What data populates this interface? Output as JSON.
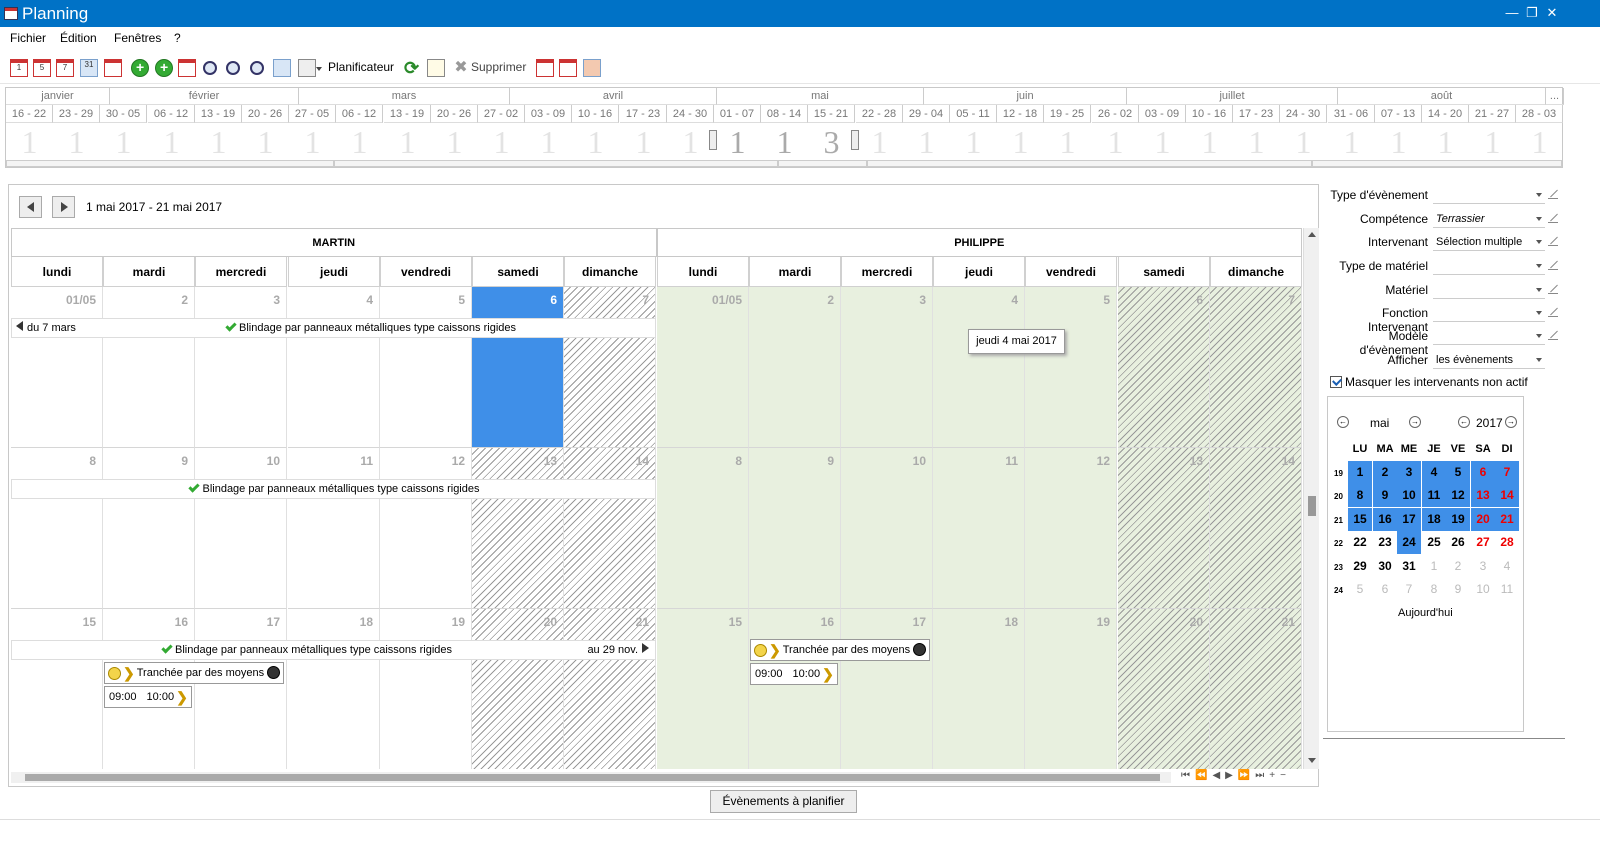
{
  "window": {
    "title": "Planning"
  },
  "menu": [
    "Fichier",
    "Édition",
    "Fenêtres",
    "?"
  ],
  "toolbar": {
    "planificateur": "Planificateur",
    "supprimer": "Supprimer",
    "cal_labels": [
      "1",
      "5",
      "7",
      "31"
    ]
  },
  "timeline": {
    "months": [
      "janvier",
      "février",
      "mars",
      "avril",
      "mai",
      "juin",
      "juillet",
      "août",
      "..."
    ],
    "weeks": [
      "16 - 22",
      "23 - 29",
      "30 - 05",
      "06 - 12",
      "13 - 19",
      "20 - 26",
      "27 - 05",
      "06 - 12",
      "13 - 19",
      "20 - 26",
      "27 - 02",
      "03 - 09",
      "10 - 16",
      "17 - 23",
      "24 - 30",
      "01 - 07",
      "08 - 14",
      "15 - 21",
      "22 - 28",
      "29 - 04",
      "05 - 11",
      "12 - 18",
      "19 - 25",
      "26 - 02",
      "03 - 09",
      "10 - 16",
      "17 - 23",
      "24 - 30",
      "31 - 06",
      "07 - 13",
      "14 - 20",
      "21 - 27",
      "28 - 03"
    ],
    "counts": [
      "1",
      "1",
      "1",
      "1",
      "1",
      "1",
      "1",
      "1",
      "1",
      "1",
      "1",
      "1",
      "1",
      "1",
      "1",
      "1",
      "1",
      "3",
      "1",
      "1",
      "1",
      "1",
      "1",
      "1",
      "1",
      "1",
      "1",
      "1",
      "1",
      "1",
      "1",
      "1",
      "1"
    ]
  },
  "planning": {
    "range": "1 mai 2017 - 21 mai 2017",
    "persons": [
      "MARTIN",
      "PHILIPPE"
    ],
    "days": [
      "lundi",
      "mardi",
      "mercredi",
      "jeudi",
      "vendredi",
      "samedi",
      "dimanche"
    ],
    "weeks": [
      [
        "01/05",
        "2",
        "3",
        "4",
        "5",
        "6",
        "7"
      ],
      [
        "8",
        "9",
        "10",
        "11",
        "12",
        "13",
        "14"
      ],
      [
        "15",
        "16",
        "17",
        "18",
        "19",
        "20",
        "21"
      ]
    ],
    "event_title": "Blindage par panneaux métalliques type caissons rigides",
    "from_label": "du 7 mars",
    "to_label": "au 29 nov.",
    "trench_label": "Tranchée par des moyens",
    "time_from": "09:00",
    "time_to": "10:00",
    "tooltip": "jeudi 4 mai 2017"
  },
  "bottom_button": "Évènements à planifier",
  "filters": [
    {
      "label": "Type d'évènement",
      "value": ""
    },
    {
      "label": "Compétence",
      "value": "Terrassier"
    },
    {
      "label": "Intervenant",
      "value": "Sélection multiple"
    },
    {
      "label": "Type de matériel",
      "value": ""
    },
    {
      "label": "Matériel",
      "value": ""
    },
    {
      "label": "Fonction Intervenant",
      "value": ""
    },
    {
      "label": "Modèle d'évènement",
      "value": ""
    },
    {
      "label": "Afficher",
      "value": "les évènements"
    }
  ],
  "hide_inactive": "Masquer les intervenants non actif",
  "minical": {
    "month": "mai",
    "year": "2017",
    "heads": [
      "LU",
      "MA",
      "ME",
      "JE",
      "VE",
      "SA",
      "DI"
    ],
    "weeknums": [
      "19",
      "20",
      "21",
      "22",
      "23",
      "24"
    ],
    "rows": [
      [
        "1",
        "2",
        "3",
        "4",
        "5",
        "6",
        "7"
      ],
      [
        "8",
        "9",
        "10",
        "11",
        "12",
        "13",
        "14"
      ],
      [
        "15",
        "16",
        "17",
        "18",
        "19",
        "20",
        "21"
      ],
      [
        "22",
        "23",
        "24",
        "25",
        "26",
        "27",
        "28"
      ],
      [
        "29",
        "30",
        "31",
        "1",
        "2",
        "3",
        "4"
      ],
      [
        "5",
        "6",
        "7",
        "8",
        "9",
        "10",
        "11"
      ]
    ],
    "today": "Aujourd'hui"
  }
}
